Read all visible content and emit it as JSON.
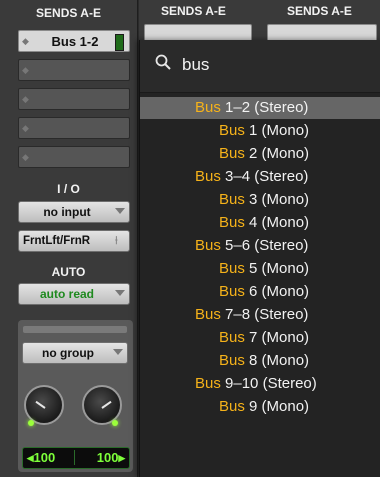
{
  "left_strip": {
    "sends_header": "SENDS A-E",
    "active_send": "Bus 1-2",
    "io_header": "I / O",
    "input": "no input",
    "output": "FrntLft/FrnR",
    "auto_header": "AUTO",
    "auto_mode": "auto read",
    "group": "no group",
    "pan_left": "100",
    "pan_right": "100"
  },
  "other_strips": {
    "header_2": "SENDS A-E",
    "header_3": "SENDS A-E"
  },
  "popup": {
    "search_value": "bus",
    "items": [
      {
        "match": "Bus",
        "rest": "1–2 (Stereo)"
      },
      {
        "match": "Bus",
        "rest": "1 (Mono)"
      },
      {
        "match": "Bus",
        "rest": "2 (Mono)"
      },
      {
        "match": "Bus",
        "rest": "3–4 (Stereo)"
      },
      {
        "match": "Bus",
        "rest": "3 (Mono)"
      },
      {
        "match": "Bus",
        "rest": "4 (Mono)"
      },
      {
        "match": "Bus",
        "rest": "5–6 (Stereo)"
      },
      {
        "match": "Bus",
        "rest": "5 (Mono)"
      },
      {
        "match": "Bus",
        "rest": "6 (Mono)"
      },
      {
        "match": "Bus",
        "rest": "7–8 (Stereo)"
      },
      {
        "match": "Bus",
        "rest": "7 (Mono)"
      },
      {
        "match": "Bus",
        "rest": "8 (Mono)"
      },
      {
        "match": "Bus",
        "rest": "9–10 (Stereo)"
      },
      {
        "match": "Bus",
        "rest": "9 (Mono)"
      }
    ]
  },
  "colors": {
    "match_highlight": "#f5b21a",
    "auto_read": "#1f8a1f",
    "pan_text": "#7dff3a",
    "selected_row": "#666666"
  }
}
